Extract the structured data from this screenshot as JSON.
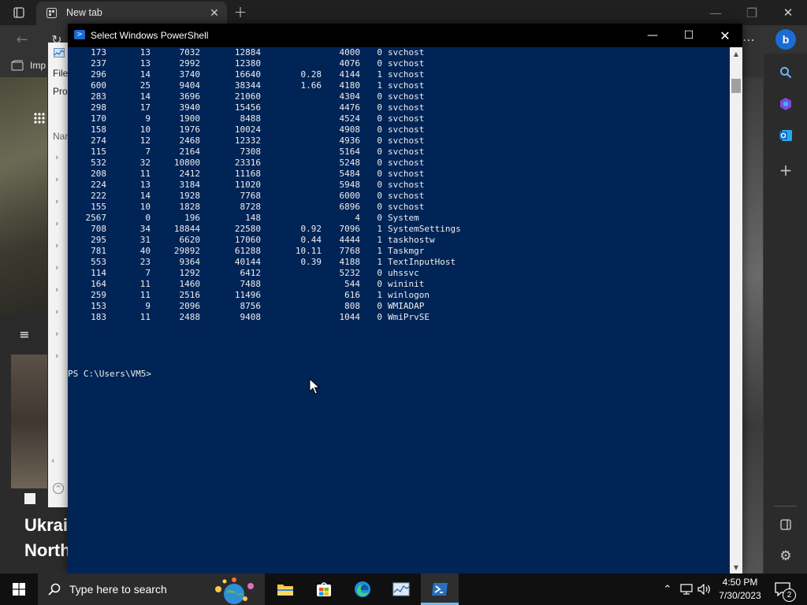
{
  "edge": {
    "tab_title": "New tab",
    "favorites_label": "Imp",
    "news_line1": "Ukrai",
    "news_line2": "North"
  },
  "taskmgr": {
    "menu_file": "File",
    "tab_processes": "Pro",
    "col_name": "Nar"
  },
  "powershell": {
    "title": "Select Windows PowerShell",
    "prompt": "PS C:\\Users\\VM5>",
    "rows": [
      [
        "173",
        "13",
        "7032",
        "12884",
        "",
        "4000",
        "0",
        "svchost"
      ],
      [
        "237",
        "13",
        "2992",
        "12380",
        "",
        "4076",
        "0",
        "svchost"
      ],
      [
        "296",
        "14",
        "3740",
        "16640",
        "0.28",
        "4144",
        "1",
        "svchost"
      ],
      [
        "600",
        "25",
        "9404",
        "38344",
        "1.66",
        "4180",
        "1",
        "svchost"
      ],
      [
        "283",
        "14",
        "3696",
        "21060",
        "",
        "4304",
        "0",
        "svchost"
      ],
      [
        "298",
        "17",
        "3940",
        "15456",
        "",
        "4476",
        "0",
        "svchost"
      ],
      [
        "170",
        "9",
        "1900",
        "8488",
        "",
        "4524",
        "0",
        "svchost"
      ],
      [
        "158",
        "10",
        "1976",
        "10024",
        "",
        "4908",
        "0",
        "svchost"
      ],
      [
        "274",
        "12",
        "2468",
        "12332",
        "",
        "4936",
        "0",
        "svchost"
      ],
      [
        "115",
        "7",
        "2164",
        "7308",
        "",
        "5164",
        "0",
        "svchost"
      ],
      [
        "532",
        "32",
        "10800",
        "23316",
        "",
        "5248",
        "0",
        "svchost"
      ],
      [
        "208",
        "11",
        "2412",
        "11168",
        "",
        "5484",
        "0",
        "svchost"
      ],
      [
        "224",
        "13",
        "3184",
        "11020",
        "",
        "5948",
        "0",
        "svchost"
      ],
      [
        "222",
        "14",
        "1928",
        "7768",
        "",
        "6000",
        "0",
        "svchost"
      ],
      [
        "155",
        "10",
        "1828",
        "8728",
        "",
        "6896",
        "0",
        "svchost"
      ],
      [
        "2567",
        "0",
        "196",
        "148",
        "",
        "4",
        "0",
        "System"
      ],
      [
        "708",
        "34",
        "18844",
        "22580",
        "0.92",
        "7096",
        "1",
        "SystemSettings"
      ],
      [
        "295",
        "31",
        "6620",
        "17060",
        "0.44",
        "4444",
        "1",
        "taskhostw"
      ],
      [
        "781",
        "40",
        "29892",
        "61288",
        "10.11",
        "7768",
        "1",
        "Taskmgr"
      ],
      [
        "553",
        "23",
        "9364",
        "40144",
        "0.39",
        "4188",
        "1",
        "TextInputHost"
      ],
      [
        "114",
        "7",
        "1292",
        "6412",
        "",
        "5232",
        "0",
        "uhssvc"
      ],
      [
        "164",
        "11",
        "1460",
        "7488",
        "",
        "544",
        "0",
        "wininit"
      ],
      [
        "259",
        "11",
        "2516",
        "11496",
        "",
        "616",
        "1",
        "winlogon"
      ],
      [
        "153",
        "9",
        "2096",
        "8756",
        "",
        "808",
        "0",
        "WMIADAP"
      ],
      [
        "183",
        "11",
        "2488",
        "9408",
        "",
        "1044",
        "0",
        "WmiPrvSE"
      ]
    ]
  },
  "taskbar": {
    "search_placeholder": "Type here to search",
    "time": "4:50 PM",
    "date": "7/30/2023",
    "notification_count": "2"
  }
}
